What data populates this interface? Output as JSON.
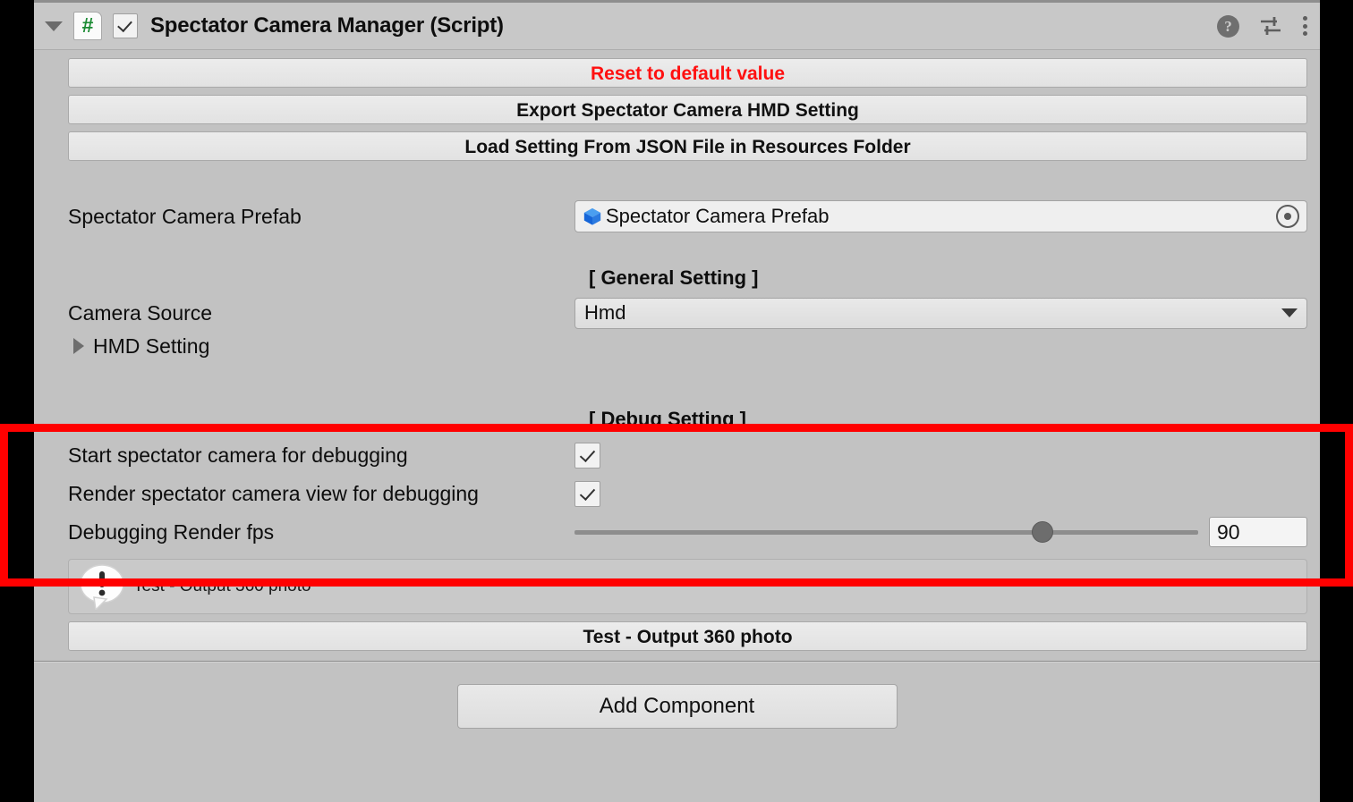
{
  "component": {
    "title": "Spectator Camera Manager (Script)",
    "script_icon": "#",
    "enabled_checkbox": true,
    "header_icons": {
      "help": "help-icon",
      "preset": "preset-icon",
      "menu": "kebab-menu-icon"
    }
  },
  "buttons": {
    "reset": "Reset to default value",
    "export": "Export Spectator Camera HMD Setting",
    "load": "Load Setting From JSON File in Resources Folder",
    "test_output": "Test - Output 360 photo",
    "add_component": "Add Component"
  },
  "prefab_row": {
    "label": "Spectator Camera Prefab",
    "value": "Spectator Camera Prefab",
    "icon": "prefab-cube-icon"
  },
  "general_setting": {
    "header": "[ General Setting ]",
    "camera_source": {
      "label": "Camera Source",
      "value": "Hmd"
    },
    "hmd_setting": {
      "label": "HMD Setting",
      "expanded": false
    }
  },
  "debug_setting": {
    "header": "[ Debug Setting ]",
    "start_spectator": {
      "label": "Start spectator camera for debugging",
      "checked": true
    },
    "render_view": {
      "label": "Render spectator camera view for debugging",
      "checked": true
    },
    "render_fps": {
      "label": "Debugging Render fps",
      "value": "90",
      "slider_percent": 75
    }
  },
  "help_box": {
    "text": "Test - Output 360 photo",
    "icon": "info-bubble-icon"
  },
  "colors": {
    "danger_text": "#ff1010",
    "highlight_box": "#ff0000",
    "panel_bg": "#c2c2c2"
  }
}
